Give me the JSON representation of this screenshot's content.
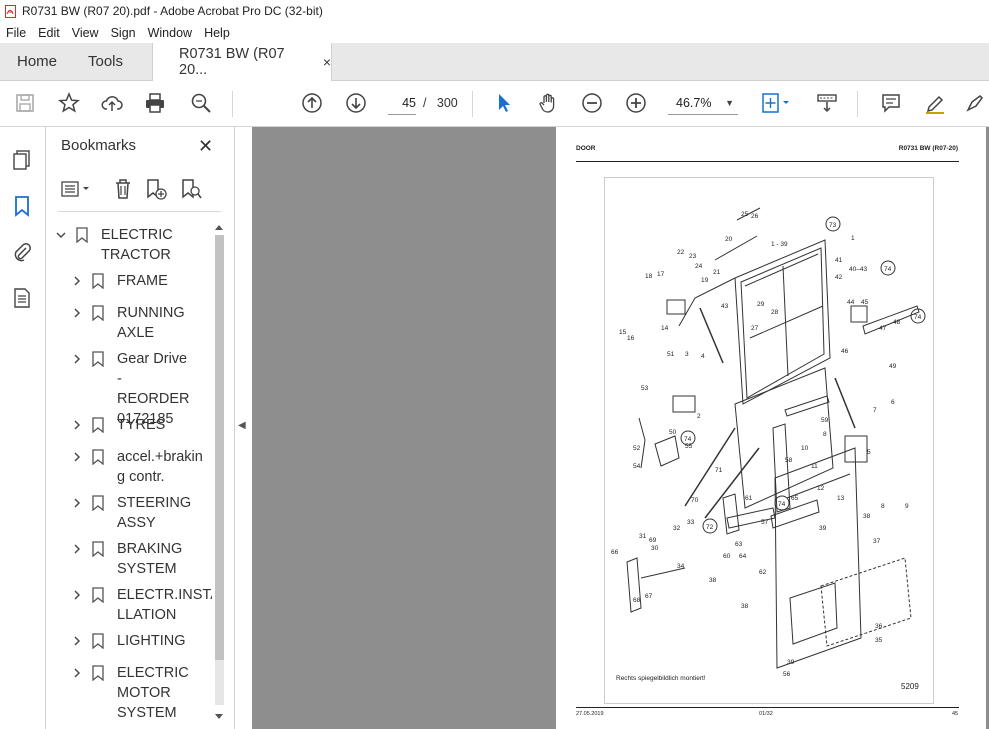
{
  "window": {
    "title": "R0731 BW (R07 20).pdf - Adobe Acrobat Pro DC (32-bit)"
  },
  "menu": [
    "File",
    "Edit",
    "View",
    "Sign",
    "Window",
    "Help"
  ],
  "tabs": {
    "home": "Home",
    "tools": "Tools",
    "document": "R0731 BW (R07 20...",
    "close": "×"
  },
  "toolbar": {
    "current_page": "45",
    "page_sep": "/",
    "total_pages": "300",
    "zoom": "46.7%"
  },
  "bookmarks": {
    "title": "Bookmarks",
    "close": "✕",
    "items": [
      {
        "label_lines": [
          "ELECTRIC",
          "TRACTOR"
        ],
        "expanded": true,
        "level": 0
      },
      {
        "label_lines": [
          "FRAME"
        ],
        "level": 1
      },
      {
        "label_lines": [
          "RUNNING",
          "AXLE"
        ],
        "level": 1
      },
      {
        "label_lines": [
          "Gear Drive -",
          "REORDER",
          "0172185"
        ],
        "level": 1
      },
      {
        "label_lines": [
          "TYRES"
        ],
        "level": 1
      },
      {
        "label_lines": [
          "accel.+brakin",
          "g contr."
        ],
        "level": 1
      },
      {
        "label_lines": [
          "STEERING",
          "ASSY"
        ],
        "level": 1
      },
      {
        "label_lines": [
          "BRAKING",
          "SYSTEM"
        ],
        "level": 1
      },
      {
        "label_lines": [
          "ELECTR.INSTA",
          "LLATION"
        ],
        "level": 1
      },
      {
        "label_lines": [
          "LIGHTING"
        ],
        "level": 1
      },
      {
        "label_lines": [
          "ELECTRIC",
          "MOTOR",
          "SYSTEM"
        ],
        "level": 1
      }
    ]
  },
  "document_page": {
    "header_left": "DOOR",
    "header_right": "R0731 BW (R07-20)",
    "footer_left": "27.05.2019",
    "footer_center": "01/32",
    "footer_right": "45",
    "figure_number": "5209",
    "figure_note": "Rechts spiegelbildlich montiert!",
    "callouts": [
      "1",
      "1 - 39",
      "2",
      "3",
      "4",
      "5",
      "6",
      "7",
      "8",
      "9",
      "10",
      "11",
      "12",
      "13",
      "14",
      "15",
      "16",
      "17",
      "18",
      "19",
      "20",
      "21",
      "22",
      "23",
      "24",
      "25",
      "26",
      "27",
      "28",
      "29",
      "30",
      "31",
      "32",
      "33",
      "34",
      "35",
      "36",
      "37",
      "38",
      "39",
      "40-43",
      "41",
      "42",
      "43",
      "44",
      "45",
      "46",
      "47",
      "48",
      "49",
      "50",
      "51",
      "52",
      "53",
      "54",
      "55",
      "56",
      "57",
      "58",
      "59",
      "60",
      "61",
      "62",
      "63",
      "64",
      "65",
      "66",
      "67",
      "68",
      "69",
      "70",
      "71",
      "72",
      "73",
      "74"
    ]
  },
  "colors": {
    "accent": "#1a6fd1",
    "viewer_bg": "#8e8e8e",
    "title_icon": "#d32f2f"
  }
}
